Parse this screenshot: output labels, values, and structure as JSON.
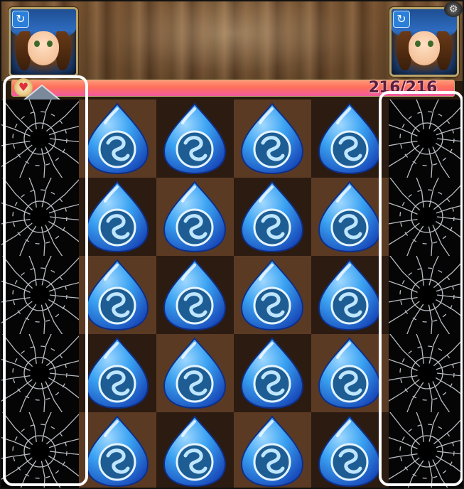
{
  "hud": {
    "hp_text": "216/216",
    "hp_current": 216,
    "hp_max": 216,
    "portrait_badge_glyph": "↻"
  },
  "board": {
    "rows": 5,
    "cols": 6,
    "columns": [
      {
        "type": "cracked",
        "highlighted": true
      },
      {
        "type": "orb",
        "element": "water"
      },
      {
        "type": "orb",
        "element": "water"
      },
      {
        "type": "orb",
        "element": "water"
      },
      {
        "type": "orb",
        "element": "water"
      },
      {
        "type": "cracked",
        "highlighted": true
      }
    ]
  },
  "colors": {
    "orb_light": "#9fd8ff",
    "orb_mid": "#3aa2f2",
    "orb_dark": "#1747b8",
    "hp_fill": "#ff6e5a",
    "highlight": "#ffffff"
  }
}
